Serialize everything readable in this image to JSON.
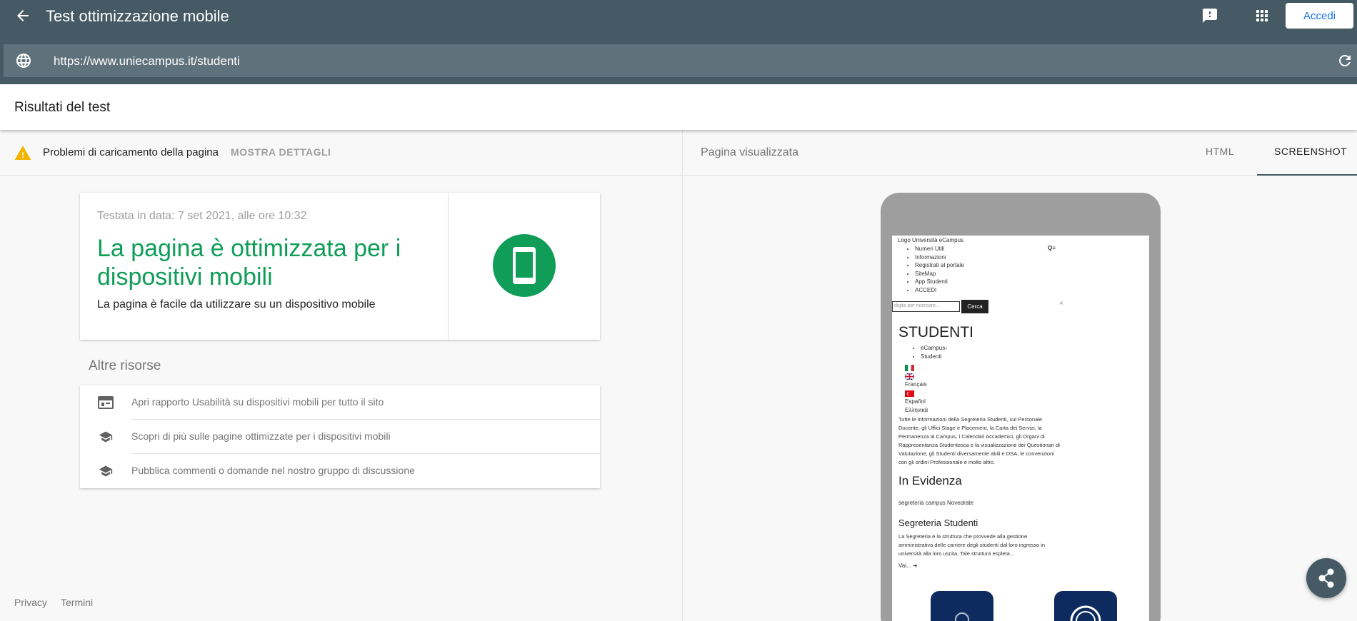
{
  "appbar": {
    "title": "Test ottimizzazione mobile",
    "signin_label": "Accedi",
    "url": "https://www.uniecampus.it/studenti"
  },
  "results": {
    "title": "Risultati del test"
  },
  "issue": {
    "text": "Problemi di caricamento della pagina",
    "details_label": "MOSTRA DETTAGLI"
  },
  "verdict": {
    "date": "Testata in data: 7 set 2021, alle ore 10:32",
    "headline": "La pagina è ottimizzata per i dispositivi mobili",
    "subtitle": "La pagina è facile da utilizzare su un dispositivo mobile",
    "accent_color": "#0f9d58"
  },
  "resources": {
    "title": "Altre risorse",
    "items": [
      {
        "icon": "report-icon",
        "label": "Apri rapporto Usabilità su dispositivi mobili per tutto il sito"
      },
      {
        "icon": "school-icon",
        "label": "Scopri di più sulle pagine ottimizzate per i dispositivi mobili"
      },
      {
        "icon": "school-icon",
        "label": "Pubblica commenti o domande nel nostro gruppo di discussione"
      }
    ]
  },
  "footer": {
    "privacy": "Privacy",
    "terms": "Termini"
  },
  "preview": {
    "title": "Pagina visualizzata",
    "tabs": [
      "HTML",
      "SCREENSHOT"
    ],
    "active_tab": "SCREENSHOT"
  },
  "screenshot": {
    "logo_alt": "Logo Università eCampus",
    "menu_items": [
      "Numeri Utili",
      "Informazioni",
      "Registrati al portale",
      "SiteMap",
      "App Studenti",
      "ACCEDI"
    ],
    "search_placeholder": "digita per ricercare...",
    "search_button": "Cerca",
    "close_glyph": "×",
    "heading": "STUDENTI",
    "breadcrumb": [
      "eCampus›",
      "Studenti"
    ],
    "languages": [
      "Français",
      "Español",
      "Ελληνικά"
    ],
    "intro": "Tutte le informazioni della Segreteria Studenti, sul Personale Docente, gli Uffici Stage e Placement, la Carta dei Servizi, la Permanenza al Campus, i Calendari Accademici, gli Organi di Rappresentanza Studentesca e la visualizzazione dei Questionari di Valutazione, gli Studenti diversamente abili e DSA, le convenzioni con gli ordini Professionale e molto altro.",
    "highlight_title": "In Evidenza",
    "highlight_img_alt": "segreteria campus Novedrate",
    "section_title": "Segreteria Studenti",
    "section_text": "La Segreteria è la struttura che provvede alla gestione amministrativa delle carriere degli studenti dal loro ingresso in università alla loro uscita. Tale struttura espleta…",
    "more_link": "Vai..."
  }
}
